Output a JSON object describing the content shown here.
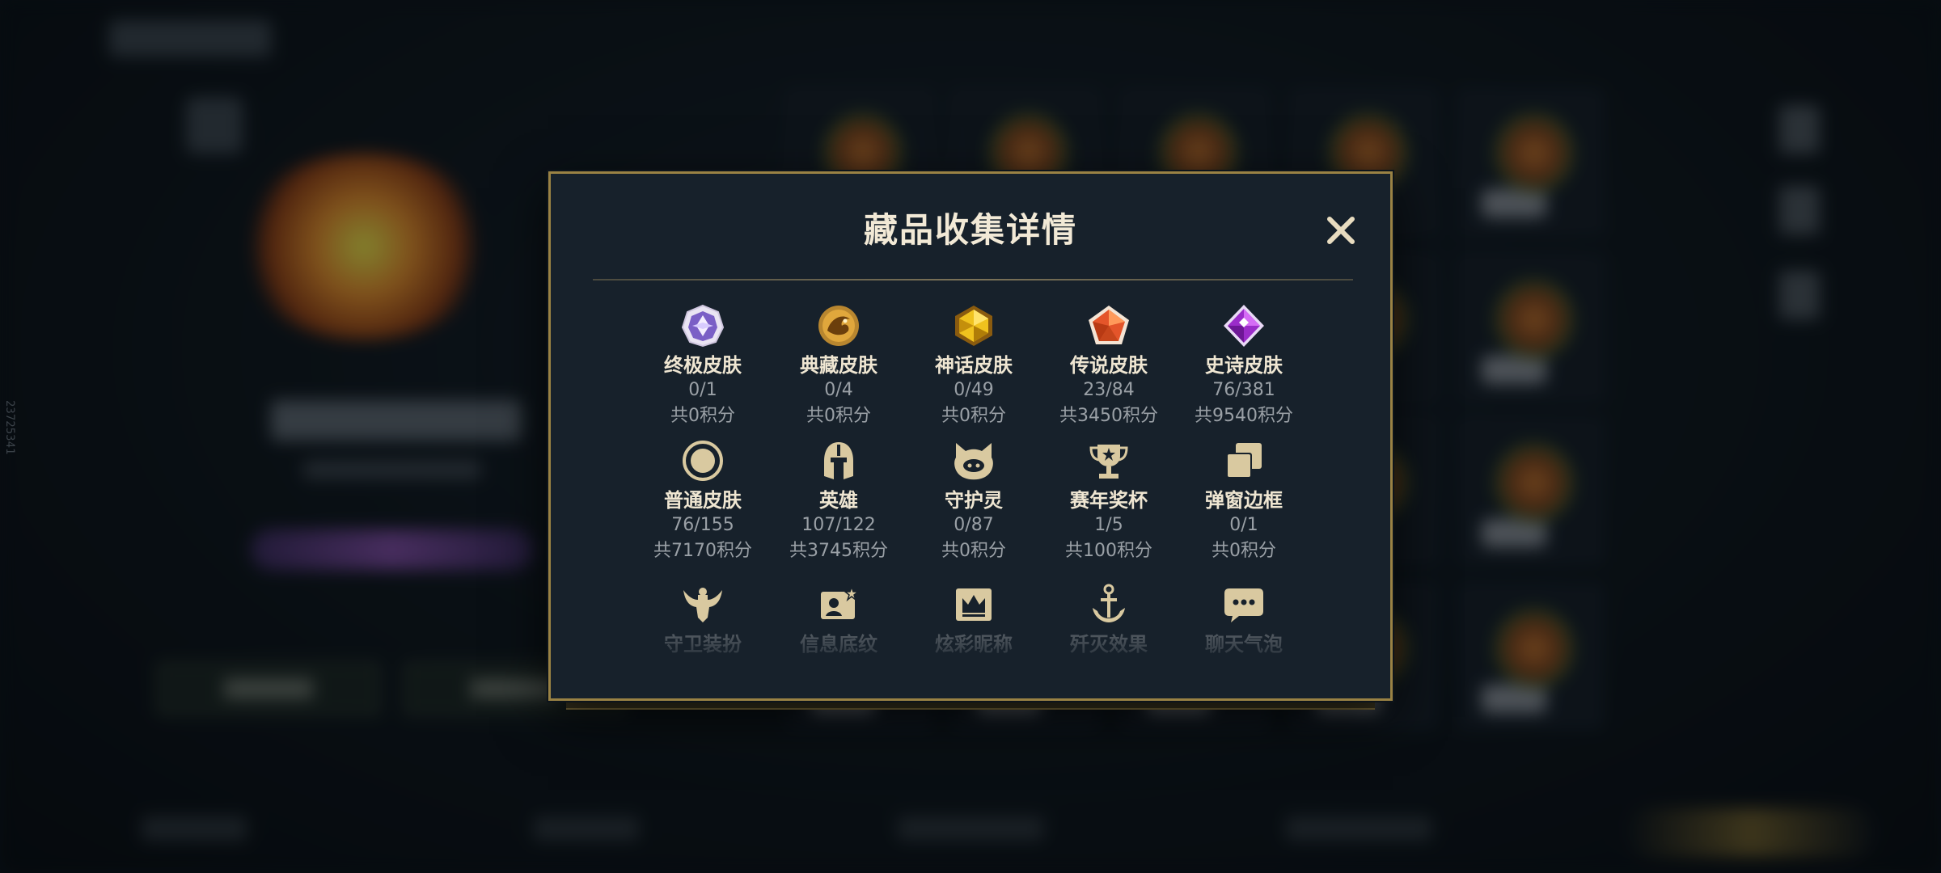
{
  "modal": {
    "title": "藏品收集详情"
  },
  "side_code": "23725341",
  "categories": [
    {
      "name": "终极皮肤",
      "count": "0/1",
      "points": "共0积分"
    },
    {
      "name": "典藏皮肤",
      "count": "0/4",
      "points": "共0积分"
    },
    {
      "name": "神话皮肤",
      "count": "0/49",
      "points": "共0积分"
    },
    {
      "name": "传说皮肤",
      "count": "23/84",
      "points": "共3450积分"
    },
    {
      "name": "史诗皮肤",
      "count": "76/381",
      "points": "共9540积分"
    },
    {
      "name": "普通皮肤",
      "count": "76/155",
      "points": "共7170积分"
    },
    {
      "name": "英雄",
      "count": "107/122",
      "points": "共3745积分"
    },
    {
      "name": "守护灵",
      "count": "0/87",
      "points": "共0积分"
    },
    {
      "name": "赛年奖杯",
      "count": "1/5",
      "points": "共100积分"
    },
    {
      "name": "弹窗边框",
      "count": "0/1",
      "points": "共0积分"
    },
    {
      "name": "守卫装扮"
    },
    {
      "name": "信息底纹"
    },
    {
      "name": "炫彩昵称"
    },
    {
      "name": "歼灭效果"
    },
    {
      "name": "聊天气泡"
    }
  ],
  "icons": [
    "ultimate-skin-icon",
    "prestige-skin-icon",
    "mythic-skin-icon",
    "legendary-skin-icon",
    "epic-skin-icon",
    "normal-skin-icon",
    "hero-icon",
    "guardian-spirit-icon",
    "season-trophy-icon",
    "popup-frame-icon",
    "ward-skin-icon",
    "info-pattern-icon",
    "colorful-nickname-icon",
    "annihilation-effect-icon",
    "chat-bubble-icon"
  ],
  "colors": {
    "modal_border": "#9a8244",
    "modal_bg": "#17212b",
    "title_text": "#f2e9d6",
    "muted_text": "#9aa0a6",
    "gold_icon": "#d9c9a0"
  }
}
